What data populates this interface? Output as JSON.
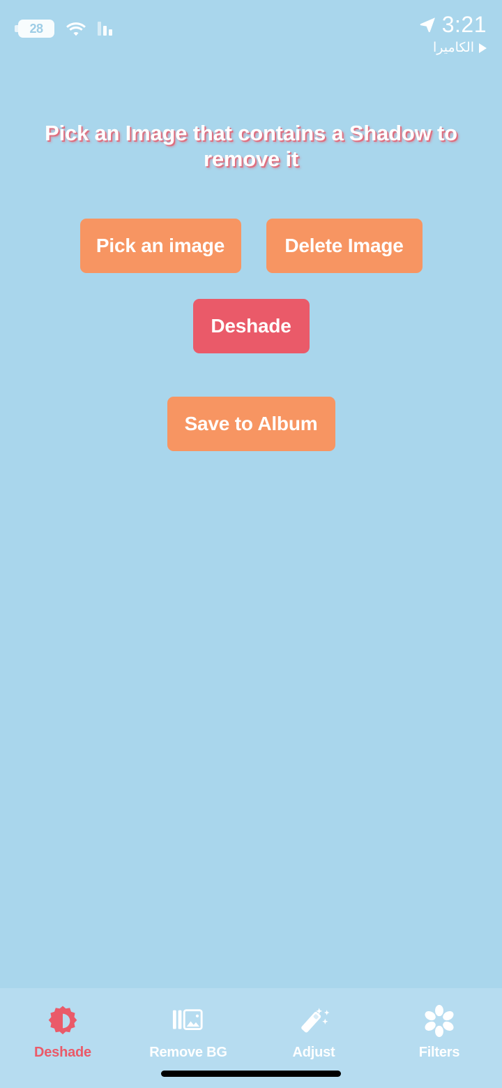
{
  "status_bar": {
    "battery_percent": "28",
    "battery_icon": "battery-icon",
    "wifi_icon": "wifi-icon",
    "cellular_icon": "cellular-bars-icon",
    "location_icon": "location-arrow-icon",
    "time": "3:21",
    "active_app_name": "الكاميرا",
    "back_to_app_icon": "play-triangle-icon"
  },
  "main": {
    "title": "Pick an Image that contains a Shadow to remove it",
    "buttons": {
      "pick_image": "Pick an image",
      "delete_image": "Delete Image",
      "deshade": "Deshade",
      "save_to_album": "Save to Album"
    }
  },
  "tab_bar": {
    "tabs": [
      {
        "label": "Deshade",
        "icon": "brightness-contrast-icon",
        "active": true
      },
      {
        "label": "Remove BG",
        "icon": "photo-layers-icon",
        "active": false
      },
      {
        "label": "Adjust",
        "icon": "magic-wand-icon",
        "active": false
      },
      {
        "label": "Filters",
        "icon": "flower-aperture-icon",
        "active": false
      }
    ]
  },
  "colors": {
    "background": "#a9d6ec",
    "tab_bar_background": "#b6dcf0",
    "primary_button": "#f79562",
    "accent_button": "#ea5a69",
    "active_tab": "#ea5a69",
    "text_on_button": "#ffffff",
    "title_shadow": "#e95a6a"
  }
}
